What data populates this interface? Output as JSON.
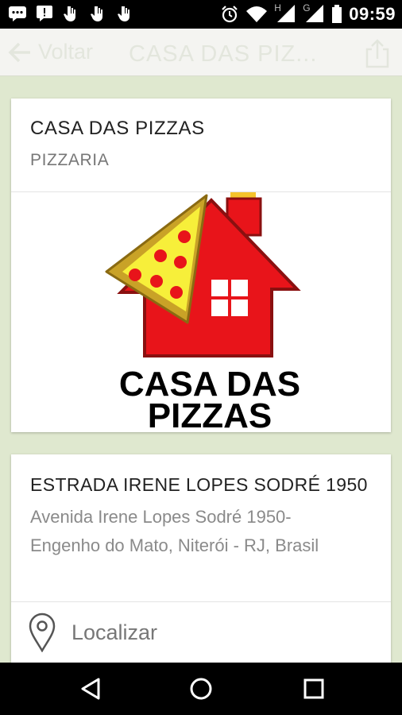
{
  "status_bar": {
    "time": "09:59",
    "left_icons": [
      "chat-icon",
      "alert-icon",
      "hand-icon",
      "hand-icon",
      "hand-icon"
    ],
    "right_icons": [
      "alarm-icon",
      "wifi-icon",
      "signal-h-icon",
      "signal-g-icon",
      "battery-icon"
    ],
    "network_h": "H",
    "network_g": "G"
  },
  "app_bar": {
    "back_label": "Voltar",
    "title": "CASA DAS PIZ...",
    "share_icon": "share-icon"
  },
  "business": {
    "name": "CASA DAS PIZZAS",
    "category": "PIZZARIA",
    "logo": {
      "line1": "CASA DAS",
      "line2": "PIZZAS",
      "house_color": "#e8141a",
      "crust_color": "#c9a227",
      "cheese_color": "#f7ef3a",
      "pepperoni_color": "#e8141a"
    }
  },
  "address": {
    "street": "ESTRADA IRENE LOPES SODRÉ 1950",
    "full_line1": "Avenida Irene Lopes Sodré 1950-",
    "full_line2": "Engenho do Mato, Niterói - RJ, Brasil"
  },
  "actions": {
    "locate_label": "Localizar",
    "locate_icon": "map-pin-icon"
  },
  "nav_bar": {
    "icons": [
      "back-triangle-icon",
      "home-circle-icon",
      "recents-square-icon"
    ]
  }
}
